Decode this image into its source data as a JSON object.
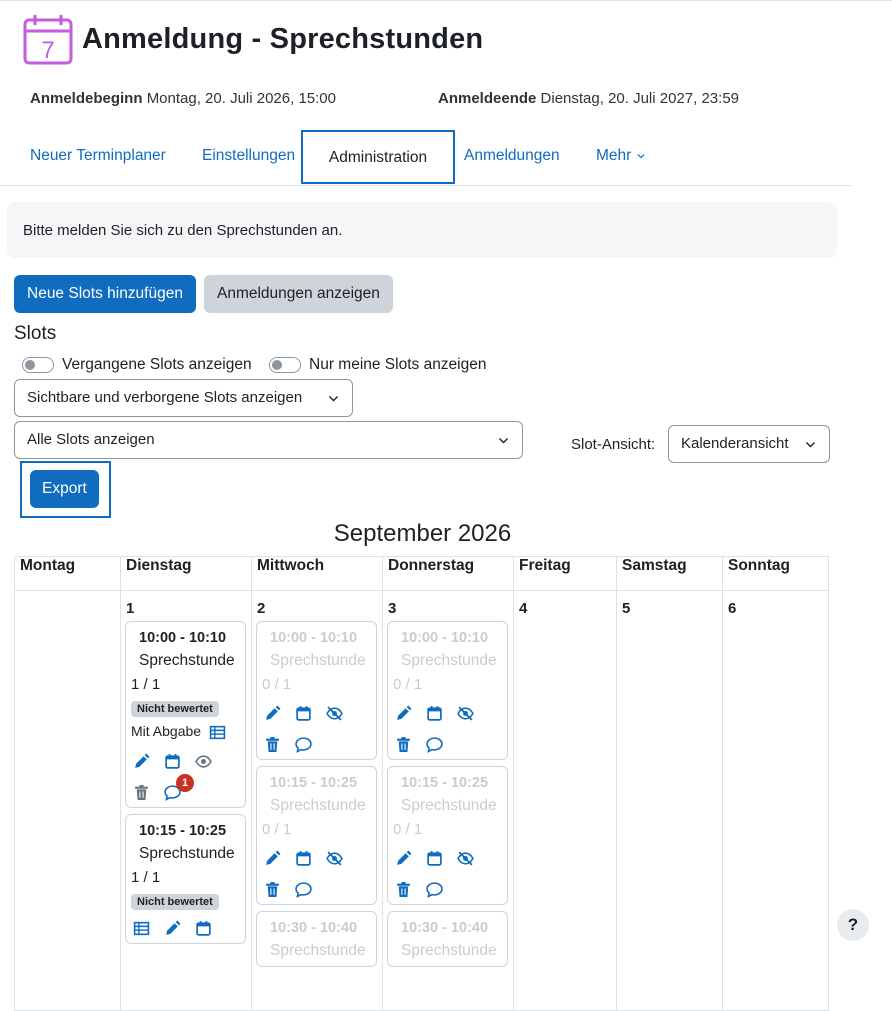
{
  "page": {
    "title": "Anmeldung - Sprechstunden",
    "icon_text": "7",
    "start_label": "Anmeldebeginn",
    "start_value": "Montag, 20. Juli 2026, 15:00",
    "end_label": "Anmeldeende",
    "end_value": "Dienstag, 20. Juli 2027, 23:59",
    "accent_color": "#0f6cbf",
    "icon_color": "#c05de0"
  },
  "nav": {
    "items": [
      {
        "label": "Neuer Terminplaner"
      },
      {
        "label": "Einstellungen"
      },
      {
        "label": "Administration"
      },
      {
        "label": "Anmeldungen"
      },
      {
        "label": "Mehr"
      }
    ],
    "active": "Administration"
  },
  "info": {
    "text": "Bitte melden Sie sich zu den Sprechstunden an."
  },
  "buttons": {
    "add_slots": "Neue Slots hinzufügen",
    "show_bookings": "Anmeldungen anzeigen",
    "export": "Export",
    "help": "?"
  },
  "slots_section": {
    "title": "Slots",
    "toggle_past": "Vergangene Slots anzeigen",
    "toggle_mine": "Nur meine Slots anzeigen",
    "visibility_select": "Sichtbare und verborgene Slots anzeigen",
    "filter_select": "Alle Slots anzeigen",
    "view_label": "Slot-Ansicht:",
    "view_select": "Kalenderansicht"
  },
  "calendar": {
    "month": "September 2026",
    "weekdays": [
      "Montag",
      "Dienstag",
      "Mittwoch",
      "Donnerstag",
      "Freitag",
      "Samstag",
      "Sonntag"
    ],
    "days": [
      "1",
      "2",
      "3",
      "4",
      "5",
      "6"
    ],
    "tuesday_slots": [
      {
        "time": "10:00 - 10:10",
        "name": "Sprechstunde",
        "capacity": "1 / 1",
        "badge": "Nicht bewertet",
        "submission": "Mit Abgabe",
        "notifications": "1"
      },
      {
        "time": "10:15 - 10:25",
        "name": "Sprechstunde",
        "capacity": "1 / 1",
        "badge": "Nicht bewertet"
      }
    ],
    "wednesday_slots": [
      {
        "time": "10:00 - 10:10",
        "name": "Sprechstunde",
        "capacity": "0 / 1"
      },
      {
        "time": "10:15 - 10:25",
        "name": "Sprechstunde",
        "capacity": "0 / 1"
      },
      {
        "time": "10:30 - 10:40",
        "name": "Sprechstunde"
      }
    ],
    "thursday_slots": [
      {
        "time": "10:00 - 10:10",
        "name": "Sprechstunde",
        "capacity": "0 / 1"
      },
      {
        "time": "10:15 - 10:25",
        "name": "Sprechstunde",
        "capacity": "0 / 1"
      },
      {
        "time": "10:30 - 10:40",
        "name": "Sprechstunde"
      }
    ]
  }
}
